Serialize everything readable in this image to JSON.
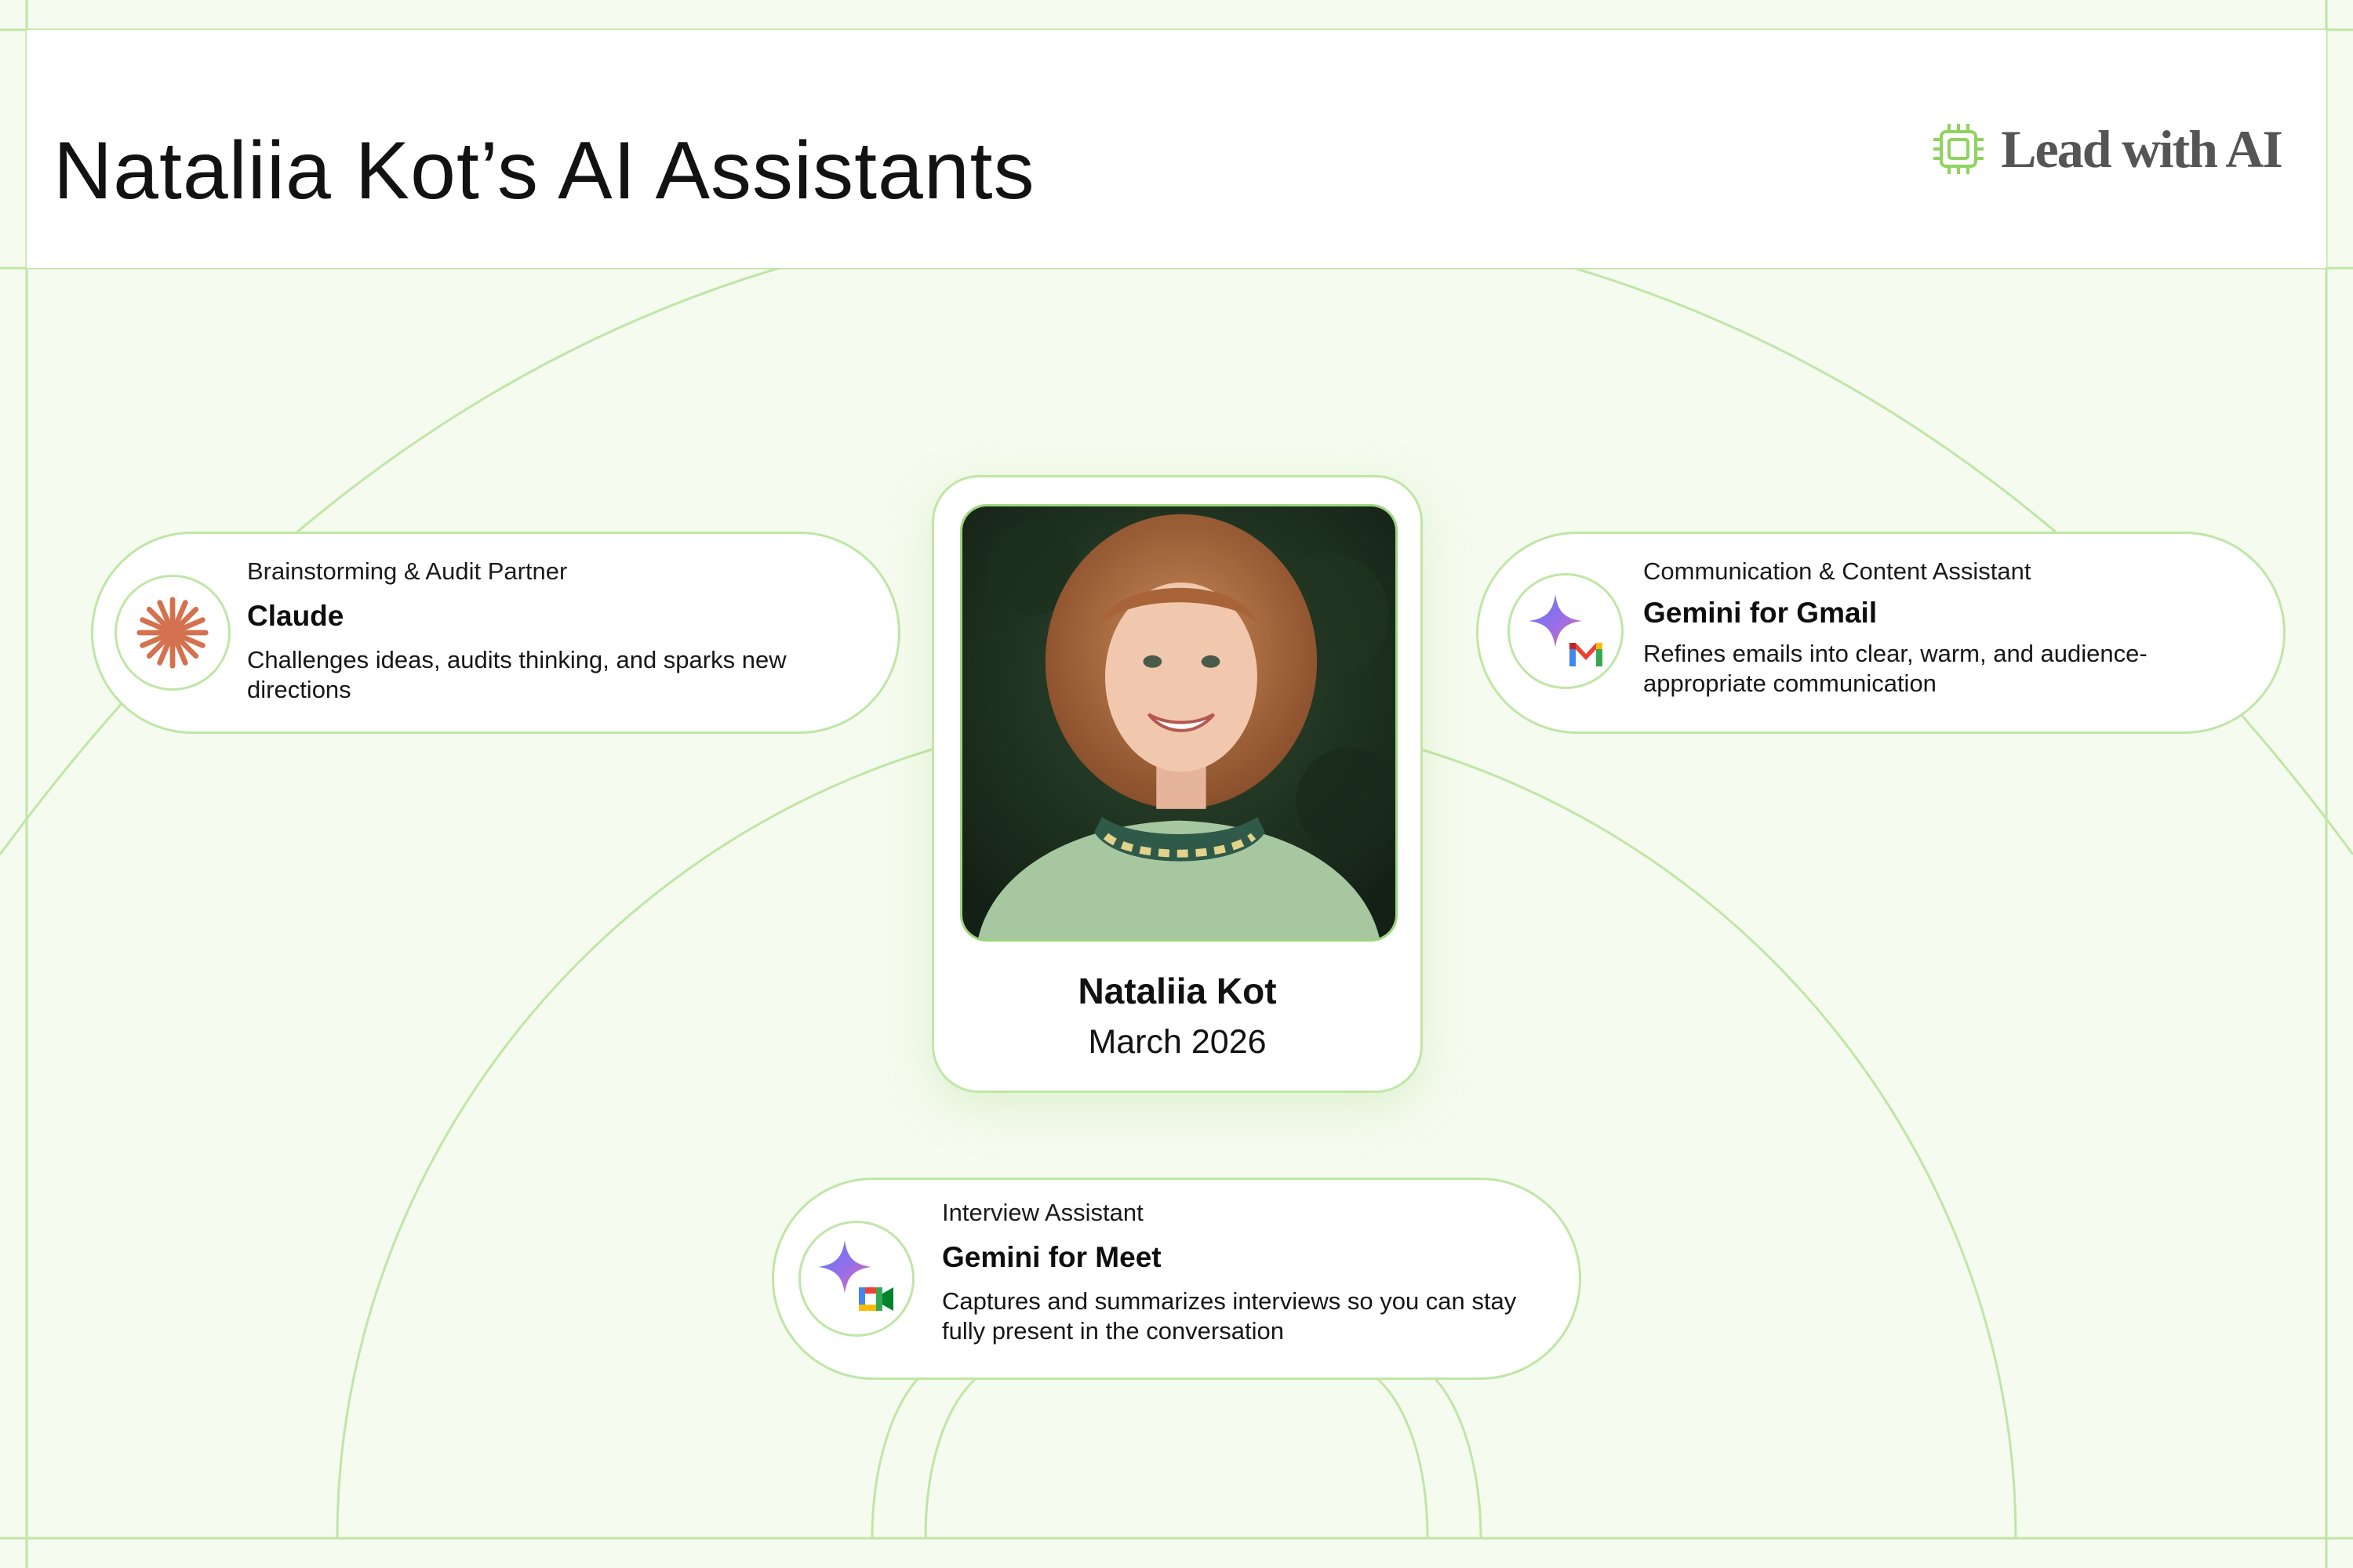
{
  "header": {
    "title": "Nataliia Kot’s AI Assistants",
    "brand": "Lead with AI"
  },
  "profile": {
    "name": "Nataliia Kot",
    "date": "March 2026"
  },
  "assistants": [
    {
      "category": "Brainstorming & Audit Partner",
      "name": "Claude",
      "description": "Challenges ideas, audits thinking, and sparks new directions",
      "icon": "claude-logo-icon"
    },
    {
      "category": "Communication & Content Assistant",
      "name": "Gemini for Gmail",
      "description": "Refines emails into clear, warm, and audience-appropriate communication",
      "icon": "gemini-gmail-icon"
    },
    {
      "category": "Interview Assistant",
      "name": "Gemini for Meet",
      "description": "Captures and summarizes interviews so you can stay fully present in the conversation",
      "icon": "gemini-meet-icon"
    }
  ],
  "colors": {
    "background": "#f6fbef",
    "line": "#bfe6a6",
    "brand_green": "#8fd35f",
    "claude_orange": "#d4714e"
  }
}
